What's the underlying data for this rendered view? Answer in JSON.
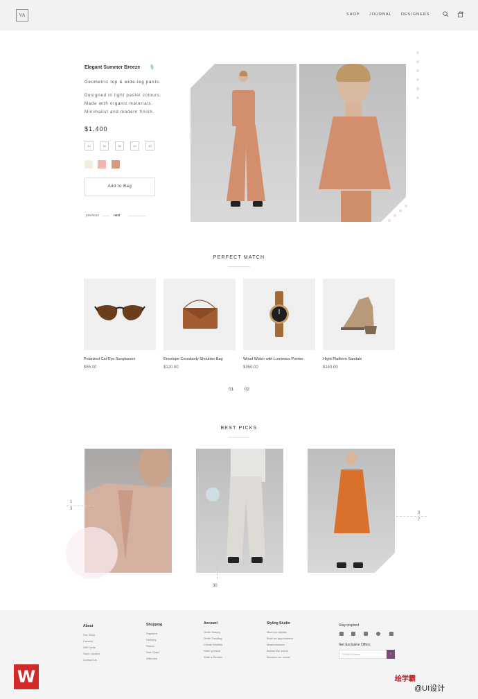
{
  "header": {
    "logo": "VA",
    "nav": [
      "SHOP",
      "JOURNAL",
      "DESIGNERS"
    ]
  },
  "product": {
    "title": "Elegant Summer Breeze",
    "subtitle": "Geometric top & wide-leg pants.",
    "description": [
      "Designed in light pastel colours.",
      "Made with organic materials.",
      "Minimalist and modern finish."
    ],
    "price": "$1,400",
    "sizes": [
      "34",
      "36",
      "38",
      "40",
      "42"
    ],
    "swatches": [
      "#f5ede1",
      "#f2b5ad",
      "#d69a7c"
    ],
    "add_to_bag": "Add to Bag",
    "previous": "previous",
    "next": "next"
  },
  "perfect_match": {
    "title": "PERFECT MATCH",
    "items": [
      {
        "name": "Polarized Cat-Eye Sunglasses",
        "price": "$55.00"
      },
      {
        "name": "Envelope Crossbody Shoulder Bag",
        "price": "$120.00"
      },
      {
        "name": "Wood Watch with Luminous Pointer",
        "price": "$350.00"
      },
      {
        "name": "Hight Platform Sandals",
        "price": "$140.00"
      }
    ],
    "pages": [
      "01",
      "02"
    ]
  },
  "best_picks": {
    "title": "BEST PICKS",
    "num_left_top": "1",
    "num_left_bottom": "3",
    "num_center": "30",
    "num_right_top": "3",
    "num_right_bottom": "7"
  },
  "footer": {
    "columns": [
      {
        "title": "About",
        "items": [
          "Our Story",
          "Careers",
          "Gift Cards",
          "Store Locator",
          "Contact Us"
        ]
      },
      {
        "title": "Shopping",
        "items": [
          "Payment",
          "Delivery",
          "Return",
          "Size Chart",
          "Aftercare"
        ]
      },
      {
        "title": "Account",
        "items": [
          "Order History",
          "Order Tracking",
          "Create Wishlist",
          "Refer a friend",
          "Write a Review"
        ]
      },
      {
        "title": "Styling Studio",
        "items": [
          "Meet our stylists",
          "Book an appointment",
          "Masterclasses",
          "Behind the scene",
          "Become our model"
        ]
      }
    ],
    "stay_inspired": "Stay inspired",
    "exclusive": "Get Exclusive Offers",
    "email_placeholder": "Email address",
    "submit": "›"
  },
  "watermark": {
    "logo": "W",
    "brand": "绘学霸",
    "ui": "@UI设计"
  }
}
